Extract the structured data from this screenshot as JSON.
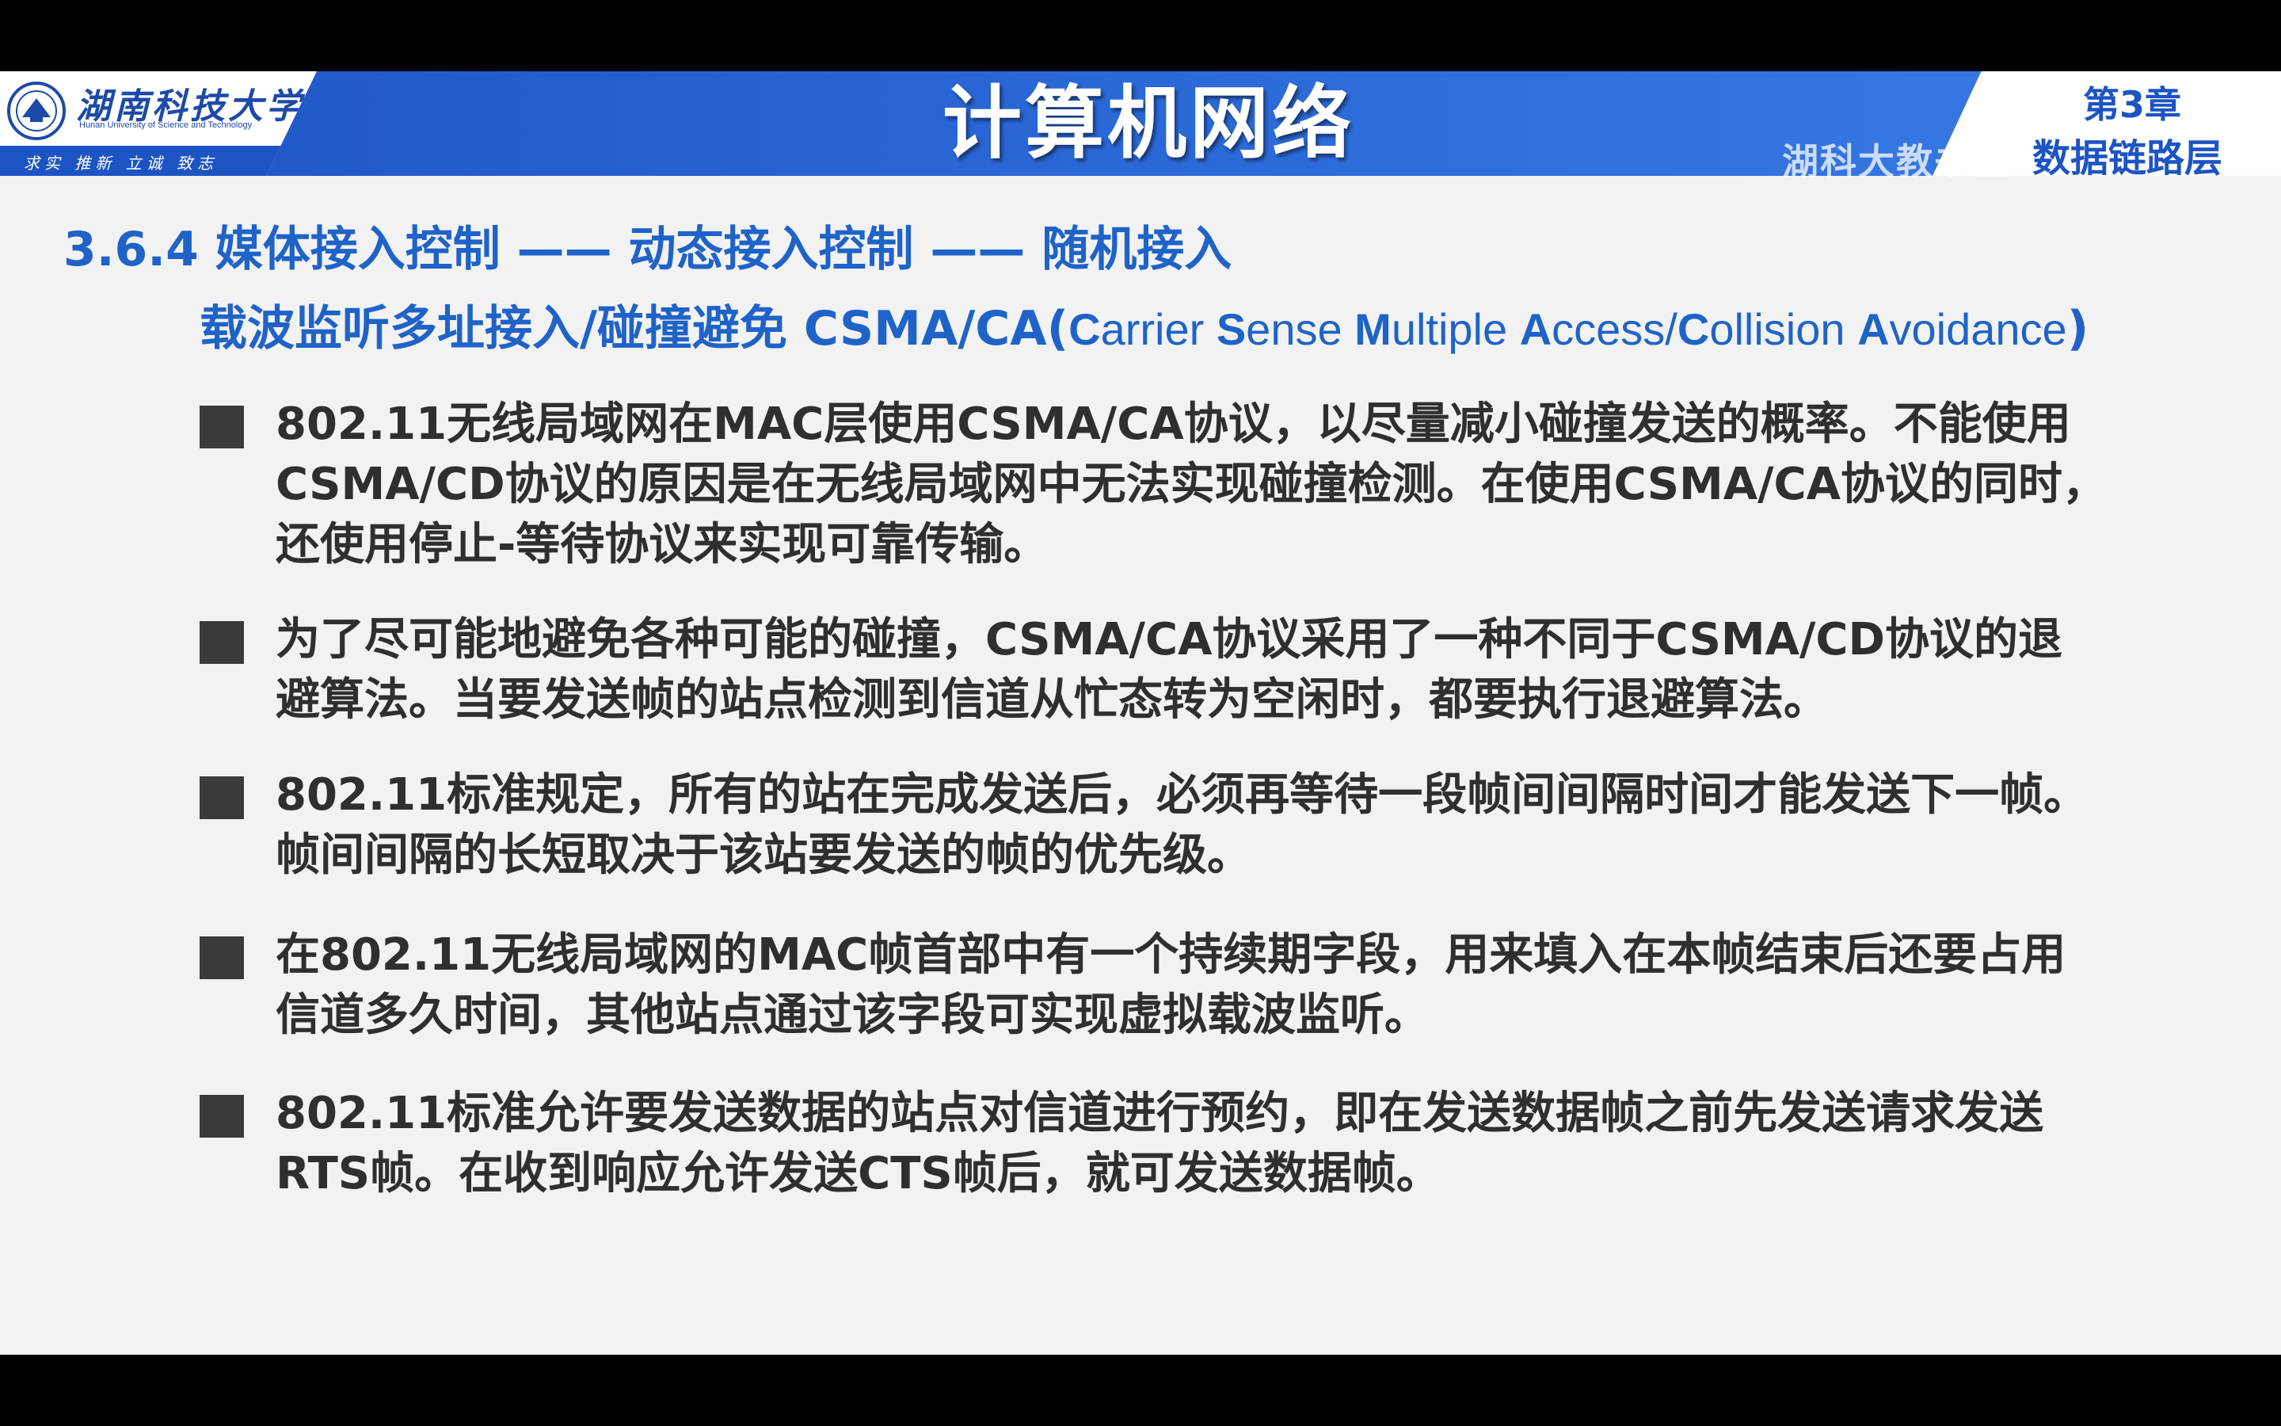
{
  "header": {
    "university_name": "湖南科技大学",
    "university_en": "Hunan University of Science and Technology",
    "motto": "求实 推新  立诚 致志",
    "course_title": "计算机网络",
    "chapter_number": "第3章",
    "chapter_name": "数据链路层",
    "watermark": "湖科大教书匠"
  },
  "heading": {
    "section": "3.6.4 媒体接入控制 —— 动态接入控制 —— 随机接入",
    "subtitle_cn": "载波监听多址接入/碰撞避免 ",
    "subtitle_abbr": "CSMA/CA(",
    "subtitle_en_parts": [
      "C",
      "arrier ",
      "S",
      "ense ",
      "M",
      "ultiple ",
      "A",
      "ccess/",
      "C",
      "ollision ",
      "A",
      "voidance",
      ")"
    ]
  },
  "bullets": [
    {
      "text": "802.11无线局域网在MAC层使用CSMA/CA协议，以尽量减小碰撞发送的概率。不能使用\nCSMA/CD协议的原因是在无线局域网中无法实现碰撞检测。在使用CSMA/CA协议的同时，\n还使用停止-等待协议来实现可靠传输。"
    },
    {
      "text": "为了尽可能地避免各种可能的碰撞，CSMA/CA协议采用了一种不同于CSMA/CD协议的退\n避算法。当要发送帧的站点检测到信道从忙态转为空闲时，都要执行退避算法。"
    },
    {
      "text": "802.11标准规定，所有的站在完成发送后，必须再等待一段帧间间隔时间才能发送下一帧。\n帧间间隔的长短取决于该站要发送的帧的优先级。"
    },
    {
      "text": "在802.11无线局域网的MAC帧首部中有一个持续期字段，用来填入在本帧结束后还要占用\n信道多久时间，其他站点通过该字段可实现虚拟载波监听。"
    },
    {
      "text": "802.11标准允许要发送数据的站点对信道进行预约，即在发送数据帧之前先发送请求发送\nRTS帧。在收到响应允许发送CTS帧后，就可发送数据帧。"
    }
  ],
  "colors": {
    "banner": "#2b68d8",
    "heading": "#1f63c8",
    "body_text": "#2f2f2f",
    "bullet_square": "#3a3a3a"
  }
}
